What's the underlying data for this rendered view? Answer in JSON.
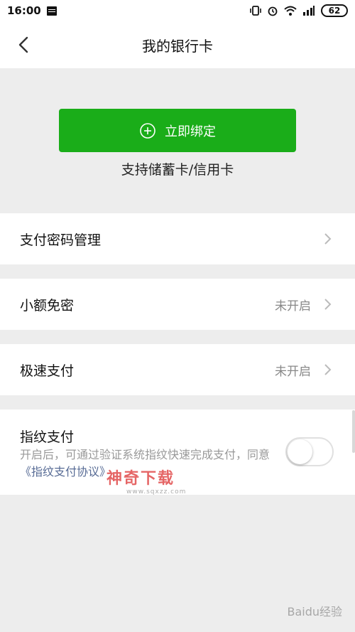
{
  "status": {
    "time": "16:00",
    "battery": "62"
  },
  "header": {
    "title": "我的银行卡"
  },
  "bind": {
    "button_label": "立即绑定",
    "note": "支持储蓄卡/信用卡"
  },
  "menu": {
    "password": {
      "label": "支付密码管理"
    },
    "small_free": {
      "label": "小额免密",
      "status": "未开启"
    },
    "fast_pay": {
      "label": "极速支付",
      "status": "未开启"
    }
  },
  "fingerprint": {
    "title": "指纹支付",
    "desc_prefix": "开启后，可通过验证系统指纹快速完成支付，同意",
    "link": "《指纹支付协议》",
    "enabled": false
  },
  "watermark": {
    "brand": "神奇下载",
    "url": "www.sqxzz.com"
  },
  "baidu_mark": "Baidu经验",
  "colors": {
    "primary": "#1aad19",
    "link": "#576b95",
    "background": "#ededed"
  },
  "icons": [
    "back-arrow-icon",
    "plus-circle-icon",
    "chevron-right-icon",
    "wifi-icon",
    "signal-icon",
    "alarm-icon",
    "vibrate-icon",
    "sim-icon"
  ]
}
